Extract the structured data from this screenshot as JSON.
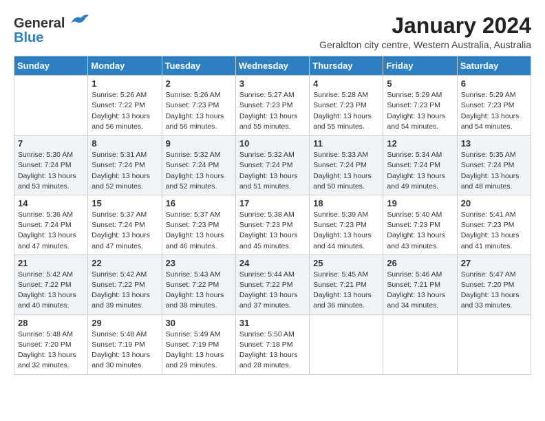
{
  "logo": {
    "general": "General",
    "blue": "Blue"
  },
  "title": "January 2024",
  "subtitle": "Geraldton city centre, Western Australia, Australia",
  "days_header": [
    "Sunday",
    "Monday",
    "Tuesday",
    "Wednesday",
    "Thursday",
    "Friday",
    "Saturday"
  ],
  "weeks": [
    [
      {
        "day": "",
        "info": ""
      },
      {
        "day": "1",
        "info": "Sunrise: 5:26 AM\nSunset: 7:22 PM\nDaylight: 13 hours\nand 56 minutes."
      },
      {
        "day": "2",
        "info": "Sunrise: 5:26 AM\nSunset: 7:23 PM\nDaylight: 13 hours\nand 56 minutes."
      },
      {
        "day": "3",
        "info": "Sunrise: 5:27 AM\nSunset: 7:23 PM\nDaylight: 13 hours\nand 55 minutes."
      },
      {
        "day": "4",
        "info": "Sunrise: 5:28 AM\nSunset: 7:23 PM\nDaylight: 13 hours\nand 55 minutes."
      },
      {
        "day": "5",
        "info": "Sunrise: 5:29 AM\nSunset: 7:23 PM\nDaylight: 13 hours\nand 54 minutes."
      },
      {
        "day": "6",
        "info": "Sunrise: 5:29 AM\nSunset: 7:23 PM\nDaylight: 13 hours\nand 54 minutes."
      }
    ],
    [
      {
        "day": "7",
        "info": "Sunrise: 5:30 AM\nSunset: 7:24 PM\nDaylight: 13 hours\nand 53 minutes."
      },
      {
        "day": "8",
        "info": "Sunrise: 5:31 AM\nSunset: 7:24 PM\nDaylight: 13 hours\nand 52 minutes."
      },
      {
        "day": "9",
        "info": "Sunrise: 5:32 AM\nSunset: 7:24 PM\nDaylight: 13 hours\nand 52 minutes."
      },
      {
        "day": "10",
        "info": "Sunrise: 5:32 AM\nSunset: 7:24 PM\nDaylight: 13 hours\nand 51 minutes."
      },
      {
        "day": "11",
        "info": "Sunrise: 5:33 AM\nSunset: 7:24 PM\nDaylight: 13 hours\nand 50 minutes."
      },
      {
        "day": "12",
        "info": "Sunrise: 5:34 AM\nSunset: 7:24 PM\nDaylight: 13 hours\nand 49 minutes."
      },
      {
        "day": "13",
        "info": "Sunrise: 5:35 AM\nSunset: 7:24 PM\nDaylight: 13 hours\nand 48 minutes."
      }
    ],
    [
      {
        "day": "14",
        "info": "Sunrise: 5:36 AM\nSunset: 7:24 PM\nDaylight: 13 hours\nand 47 minutes."
      },
      {
        "day": "15",
        "info": "Sunrise: 5:37 AM\nSunset: 7:24 PM\nDaylight: 13 hours\nand 47 minutes."
      },
      {
        "day": "16",
        "info": "Sunrise: 5:37 AM\nSunset: 7:23 PM\nDaylight: 13 hours\nand 46 minutes."
      },
      {
        "day": "17",
        "info": "Sunrise: 5:38 AM\nSunset: 7:23 PM\nDaylight: 13 hours\nand 45 minutes."
      },
      {
        "day": "18",
        "info": "Sunrise: 5:39 AM\nSunset: 7:23 PM\nDaylight: 13 hours\nand 44 minutes."
      },
      {
        "day": "19",
        "info": "Sunrise: 5:40 AM\nSunset: 7:23 PM\nDaylight: 13 hours\nand 43 minutes."
      },
      {
        "day": "20",
        "info": "Sunrise: 5:41 AM\nSunset: 7:23 PM\nDaylight: 13 hours\nand 41 minutes."
      }
    ],
    [
      {
        "day": "21",
        "info": "Sunrise: 5:42 AM\nSunset: 7:22 PM\nDaylight: 13 hours\nand 40 minutes."
      },
      {
        "day": "22",
        "info": "Sunrise: 5:42 AM\nSunset: 7:22 PM\nDaylight: 13 hours\nand 39 minutes."
      },
      {
        "day": "23",
        "info": "Sunrise: 5:43 AM\nSunset: 7:22 PM\nDaylight: 13 hours\nand 38 minutes."
      },
      {
        "day": "24",
        "info": "Sunrise: 5:44 AM\nSunset: 7:22 PM\nDaylight: 13 hours\nand 37 minutes."
      },
      {
        "day": "25",
        "info": "Sunrise: 5:45 AM\nSunset: 7:21 PM\nDaylight: 13 hours\nand 36 minutes."
      },
      {
        "day": "26",
        "info": "Sunrise: 5:46 AM\nSunset: 7:21 PM\nDaylight: 13 hours\nand 34 minutes."
      },
      {
        "day": "27",
        "info": "Sunrise: 5:47 AM\nSunset: 7:20 PM\nDaylight: 13 hours\nand 33 minutes."
      }
    ],
    [
      {
        "day": "28",
        "info": "Sunrise: 5:48 AM\nSunset: 7:20 PM\nDaylight: 13 hours\nand 32 minutes."
      },
      {
        "day": "29",
        "info": "Sunrise: 5:48 AM\nSunset: 7:19 PM\nDaylight: 13 hours\nand 30 minutes."
      },
      {
        "day": "30",
        "info": "Sunrise: 5:49 AM\nSunset: 7:19 PM\nDaylight: 13 hours\nand 29 minutes."
      },
      {
        "day": "31",
        "info": "Sunrise: 5:50 AM\nSunset: 7:18 PM\nDaylight: 13 hours\nand 28 minutes."
      },
      {
        "day": "",
        "info": ""
      },
      {
        "day": "",
        "info": ""
      },
      {
        "day": "",
        "info": ""
      }
    ]
  ]
}
